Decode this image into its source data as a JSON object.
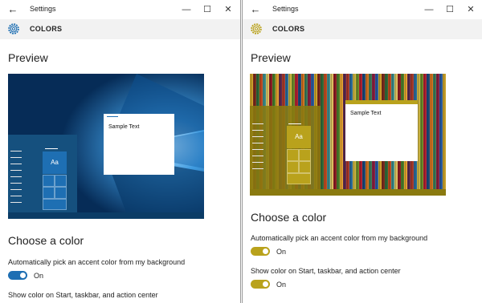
{
  "left": {
    "window_title": "Settings",
    "page_title": "COLORS",
    "preview_heading": "Preview",
    "sample_text": "Sample Text",
    "tile_text": "Aa",
    "choose_heading": "Choose a color",
    "auto_label": "Automatically pick an accent color from my background",
    "auto_state": "On",
    "show_label": "Show color on Start, taskbar, and action center",
    "accent": "#1e6fb3",
    "start_color": "#15507e"
  },
  "right": {
    "window_title": "Settings",
    "page_title": "COLORS",
    "preview_heading": "Preview",
    "sample_text": "Sample Text",
    "tile_text": "Aa",
    "choose_heading": "Choose a color",
    "auto_label": "Automatically pick an accent color from my background",
    "auto_state": "On",
    "show_label": "Show color on Start, taskbar, and action center",
    "show_state": "On",
    "accent": "#b9a21c",
    "start_color": "#8a7a10"
  },
  "icons": {
    "back": "back-arrow-icon",
    "minimize": "minimize-icon",
    "maximize": "maximize-icon",
    "close": "close-icon",
    "gear": "gear-icon"
  },
  "glyphs": {
    "back": "←",
    "minimize": "—",
    "maximize": "☐",
    "close": "✕"
  }
}
